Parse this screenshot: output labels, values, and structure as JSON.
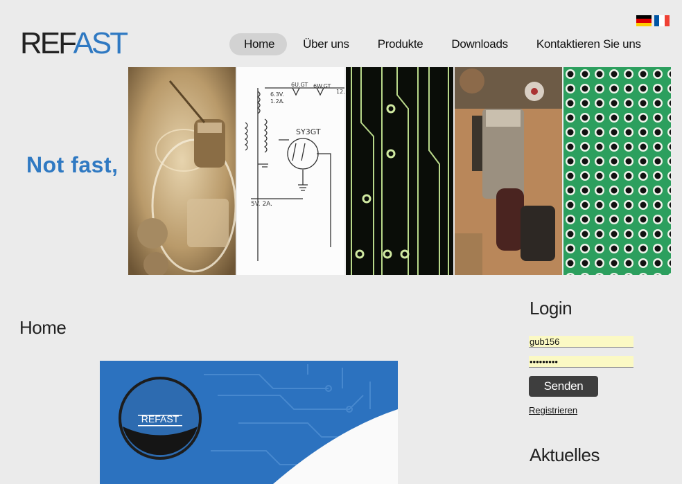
{
  "languages": [
    {
      "code": "de",
      "icon": "german-flag-icon"
    },
    {
      "code": "fr",
      "icon": "french-flag-icon"
    }
  ],
  "logo": {
    "part1": "REF",
    "part2": "AST",
    "color_primary": "#222222",
    "color_accent": "#2f79c2"
  },
  "nav": {
    "items": [
      {
        "label": "Home",
        "active": true
      },
      {
        "label": "Über uns",
        "active": false
      },
      {
        "label": "Produkte",
        "active": false
      },
      {
        "label": "Downloads",
        "active": false
      },
      {
        "label": "Kontaktieren Sie uns",
        "active": false
      }
    ]
  },
  "hero": {
    "tagline": "Not fast,",
    "images": [
      "vacuum-tube-photo",
      "circuit-schematic-drawing",
      "pcb-traces-photo",
      "electronic-components-photo",
      "pcb-holes-photo"
    ],
    "schematic_labels": [
      "6U.GT",
      "6W.GT",
      "12.",
      "6.3V.",
      "1.2A.",
      "SY3GT",
      "5V. 2A."
    ]
  },
  "main": {
    "title": "Home",
    "banner_logo_text": "REFAST"
  },
  "sidebar": {
    "login_title": "Login",
    "username_value": "gub156",
    "password_value": "•••••••••",
    "submit_label": "Senden",
    "register_label": "Registrieren",
    "news_title": "Aktuelles"
  },
  "colors": {
    "accent": "#2f79c2",
    "background": "#ebebeb",
    "input_bg": "#fbf9c4",
    "button": "#3e3e3e"
  }
}
